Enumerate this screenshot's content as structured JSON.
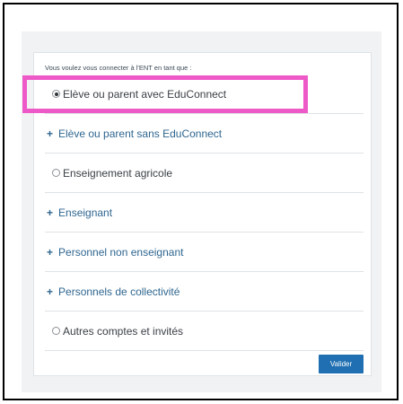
{
  "login": {
    "prompt": "Vous voulez vous connecter à l'ENT en tant que :",
    "options": [
      {
        "label": "Elève ou parent avec EduConnect",
        "type": "radio",
        "selected": true
      },
      {
        "label": "Elève ou parent sans EduConnect",
        "type": "expand"
      },
      {
        "label": "Enseignement agricole",
        "type": "radio",
        "selected": false
      },
      {
        "label": "Enseignant",
        "type": "expand"
      },
      {
        "label": "Personnel non enseignant",
        "type": "expand"
      },
      {
        "label": "Personnels de collectivité",
        "type": "expand"
      },
      {
        "label": "Autres comptes et invités",
        "type": "radio",
        "selected": false
      }
    ],
    "submit_label": "Valider",
    "plus_symbol": "+"
  },
  "colors": {
    "accent": "#1f6fb2",
    "link": "#2f6690",
    "highlight": "#ee59c8",
    "panel": "#f1f2f3"
  }
}
